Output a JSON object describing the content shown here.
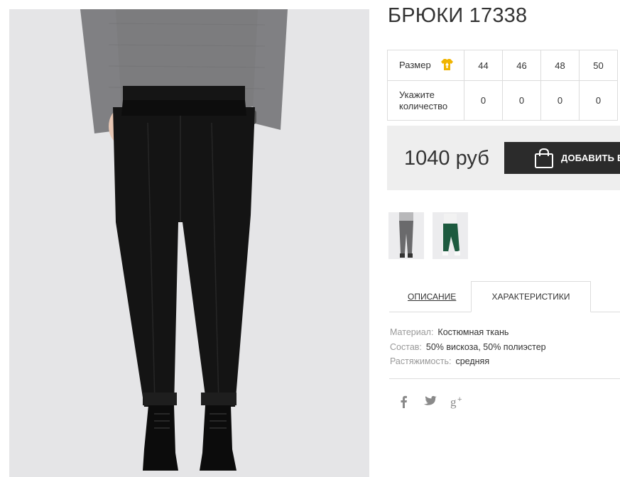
{
  "product": {
    "title": "БРЮКИ 17338",
    "photo_alt": "black trousers"
  },
  "size_table": {
    "size_label": "Размер",
    "qty_label_line1": "Укажите",
    "qty_label_line2": "количество",
    "sizes": [
      "44",
      "46",
      "48",
      "50"
    ],
    "quantities": [
      "0",
      "0",
      "0",
      "0"
    ]
  },
  "purchase": {
    "price": "1040 руб",
    "add_button_label": "ДОБАВИТЬ В"
  },
  "tabs": {
    "description": "ОПИСАНИЕ",
    "characteristics": "ХАРАКТЕРИСТИКИ",
    "active": "characteristics"
  },
  "characteristics": [
    {
      "key": "Материал:",
      "value": "Костюмная ткань"
    },
    {
      "key": "Состав:",
      "value": "50% вискоза, 50% полиэстер"
    },
    {
      "key": "Растяжимость:",
      "value": "средняя"
    }
  ],
  "social": [
    "facebook-icon",
    "twitter-icon",
    "google-plus-icon"
  ],
  "colors": {
    "button_bg": "#2b2b2b",
    "price_box_bg": "#eeeeee",
    "shirt_icon": "#f0b400",
    "thumb2_pants": "#1d5a3f"
  }
}
